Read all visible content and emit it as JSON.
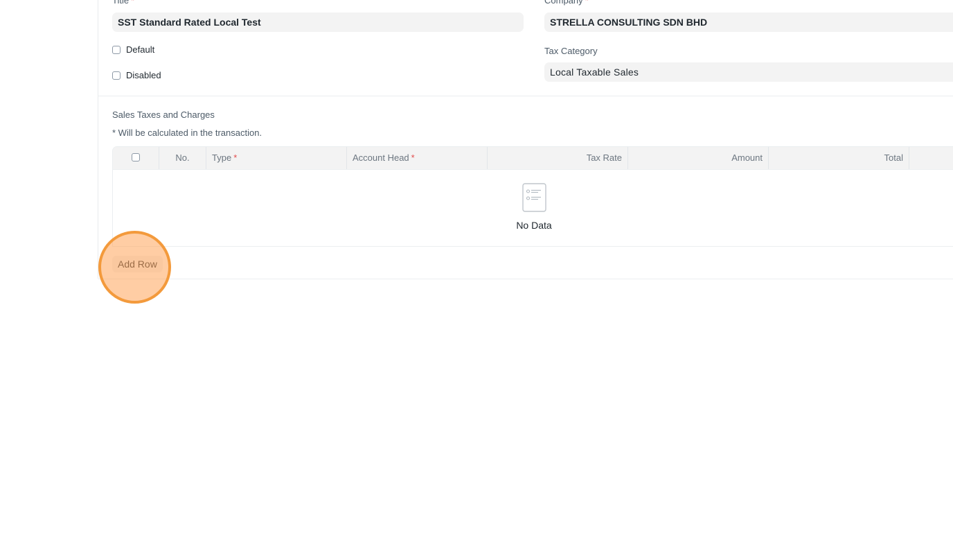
{
  "form": {
    "title_label": "Title",
    "title_value": "SST Standard Rated Local Test",
    "company_label": "Company",
    "company_value": "STRELLA CONSULTING SDN BHD",
    "default_label": "Default",
    "disabled_label": "Disabled",
    "tax_category_label": "Tax Category",
    "tax_category_value": "Local Taxable Sales",
    "required_marker": "*"
  },
  "taxes_section": {
    "heading": "Sales Taxes and Charges",
    "note": "* Will be calculated in the transaction.",
    "columns": {
      "no": "No.",
      "type": "Type",
      "account_head": "Account Head",
      "tax_rate": "Tax Rate",
      "amount": "Amount",
      "total": "Total"
    },
    "empty_text": "No Data",
    "add_row_label": "Add Row"
  },
  "icons": {
    "settings": "gear-icon",
    "empty": "empty-list-icon"
  },
  "colors": {
    "highlight_fill": "#ffb27a",
    "highlight_border": "#f39a3c",
    "required": "#e24c4c"
  }
}
